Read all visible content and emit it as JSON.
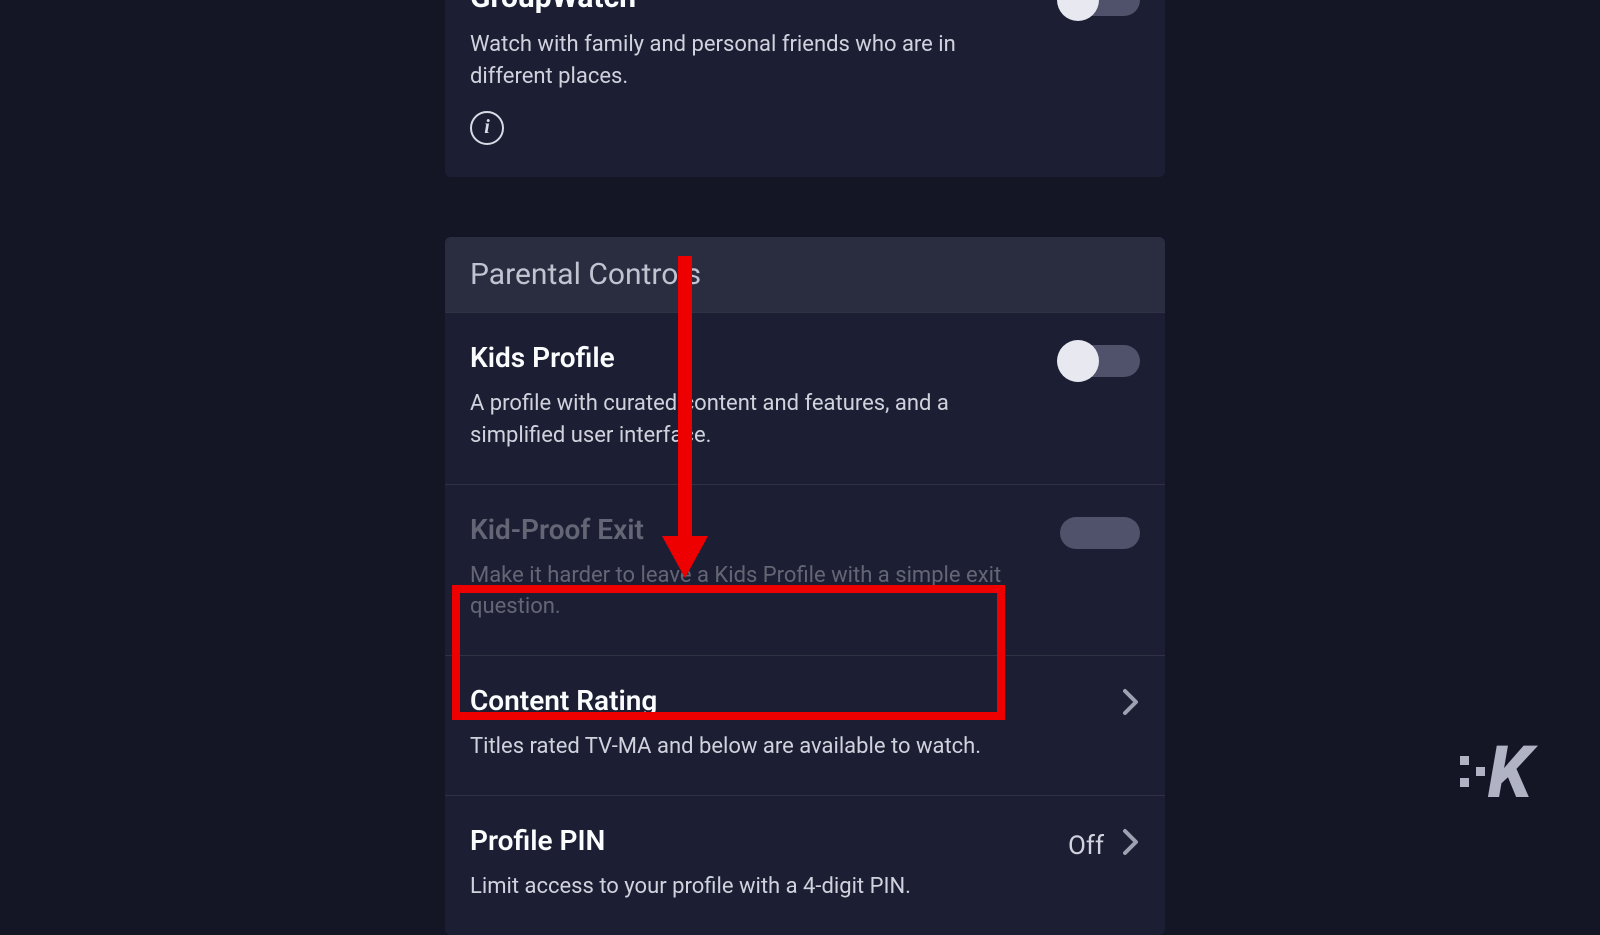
{
  "groupwatch": {
    "title": "GroupWatch",
    "desc": "Watch with family and personal friends who are in different places."
  },
  "parental": {
    "header": "Parental Controls",
    "kids_profile": {
      "title": "Kids Profile",
      "desc": "A profile with curated content and features, and a simplified user interface."
    },
    "kid_proof": {
      "title": "Kid-Proof Exit",
      "desc": "Make it harder to leave a Kids Profile with a simple exit question."
    },
    "content_rating": {
      "title": "Content Rating",
      "desc": "Titles rated TV-MA and below are available to watch."
    },
    "profile_pin": {
      "title": "Profile PIN",
      "desc": "Limit access to your profile with a 4-digit PIN.",
      "value": "Off"
    }
  },
  "watermark": "K"
}
